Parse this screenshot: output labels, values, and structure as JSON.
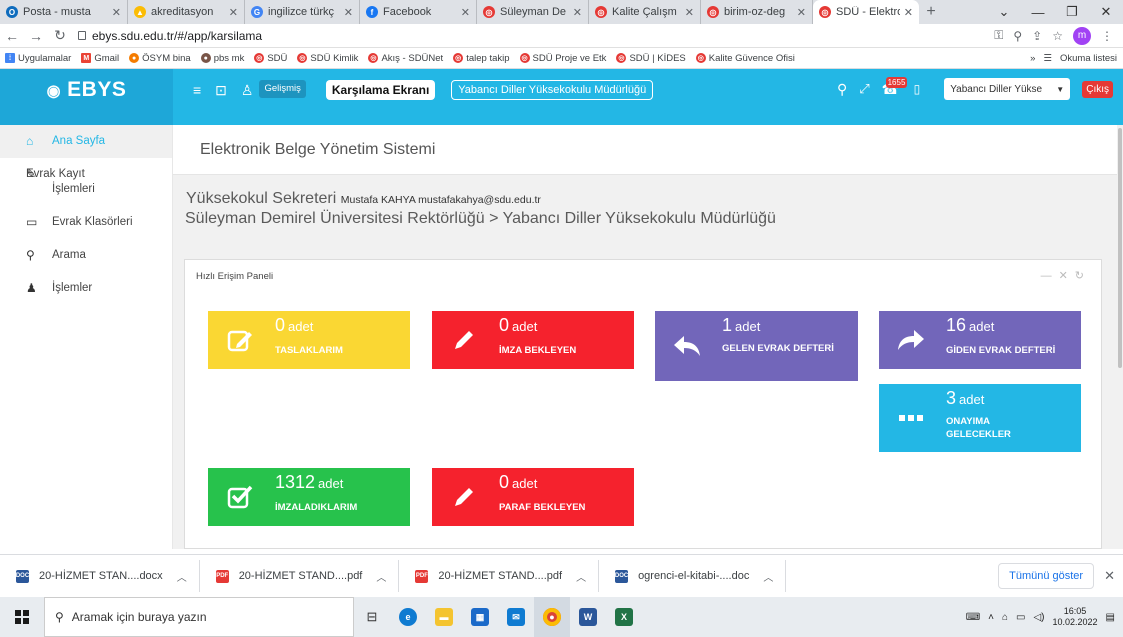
{
  "browser": {
    "tabs": [
      {
        "title": "Posta - musta",
        "icon": "outlook-icon",
        "color": "#0f6cbd",
        "glyph": "O"
      },
      {
        "title": "akreditasyon",
        "icon": "drive-icon",
        "color": "#fbbc04",
        "glyph": "▲"
      },
      {
        "title": "ingilizce türkç",
        "icon": "google-icon",
        "color": "#4285f4",
        "glyph": "G"
      },
      {
        "title": "Facebook",
        "icon": "facebook-icon",
        "color": "#1877f2",
        "glyph": "f"
      },
      {
        "title": "Süleyman De",
        "icon": "sdu-icon",
        "color": "#e53935",
        "glyph": "◎"
      },
      {
        "title": "Kalite Çalışm",
        "icon": "sdu-icon",
        "color": "#e53935",
        "glyph": "◎"
      },
      {
        "title": "birim-oz-deg",
        "icon": "sdu-icon",
        "color": "#e53935",
        "glyph": "◎"
      },
      {
        "title": "SDÜ - Elektro",
        "icon": "sdu-icon",
        "color": "#e53935",
        "glyph": "◎"
      }
    ],
    "url": "ebys.sdu.edu.tr/#/app/karsilama",
    "profile_initial": "m",
    "bookmarks": [
      {
        "label": "Uygulamalar",
        "icon": "apps-icon",
        "color": "#4285f4",
        "glyph": "⁞"
      },
      {
        "label": "Gmail",
        "icon": "gmail-icon",
        "color": "#ea4335",
        "glyph": "M"
      },
      {
        "label": "ÖSYM bina",
        "icon": "osym-icon",
        "color": "#f57c00",
        "glyph": "●"
      },
      {
        "label": "pbs mk",
        "icon": "pbs-icon",
        "color": "#795548",
        "glyph": "●"
      },
      {
        "label": "SDÜ",
        "icon": "sdu-icon",
        "color": "#e53935",
        "glyph": "◎"
      },
      {
        "label": "SDÜ Kimlik",
        "icon": "sdu-icon",
        "color": "#e53935",
        "glyph": "◎"
      },
      {
        "label": "Akış - SDÜNet",
        "icon": "sdu-icon",
        "color": "#e53935",
        "glyph": "◎"
      },
      {
        "label": "talep takip",
        "icon": "sdu-icon",
        "color": "#e53935",
        "glyph": "◎"
      },
      {
        "label": "SDÜ Proje ve Etk",
        "icon": "sdu-icon",
        "color": "#e53935",
        "glyph": "◎"
      },
      {
        "label": "SDÜ | KİDES",
        "icon": "sdu-icon",
        "color": "#e53935",
        "glyph": "◎"
      },
      {
        "label": "Kalite Güvence Ofisi",
        "icon": "sdu-icon",
        "color": "#e53935",
        "glyph": "◎"
      }
    ],
    "reading_list": "Okuma listesi"
  },
  "app": {
    "logo": "EBYS",
    "advanced": "Gelişmiş",
    "welcome": "Karşılama Ekranı",
    "unit": "Yabancı Diller Yüksekokulu Müdürlüğü",
    "notifications": "1655",
    "unit_select": "Yabancı Diller Yükse",
    "logout": "Çıkış"
  },
  "sidebar": {
    "items": [
      {
        "label": "Ana Sayfa",
        "icon": "home-icon"
      },
      {
        "label": "Evrak Kayıt İşlemleri",
        "icon": "edit-icon"
      },
      {
        "label": "Evrak Klasörleri",
        "icon": "folder-icon"
      },
      {
        "label": "Arama",
        "icon": "search-icon"
      },
      {
        "label": "İşlemler",
        "icon": "user-icon"
      }
    ]
  },
  "main": {
    "title": "Elektronik Belge Yönetim Sistemi",
    "role": "Yüksekokul Sekreteri",
    "user": "Mustafa KAHYA mustafakahya@sdu.edu.tr",
    "org": "Süleyman Demirel Üniversitesi Rektörlüğü > Yabancı Diller Yüksekokulu Müdürlüğü",
    "panel_title": "Hızlı Erişim Paneli",
    "unit_word": "adet",
    "tiles": [
      {
        "count": "0",
        "label": "TASLAKLARIM",
        "color": "#fad733"
      },
      {
        "count": "0",
        "label": "İMZA BEKLEYEN",
        "color": "#f5222d"
      },
      {
        "count": "1",
        "label": "GELEN EVRAK DEFTERİ",
        "color": "#7266ba"
      },
      {
        "count": "16",
        "label": "GİDEN EVRAK DEFTERİ",
        "color": "#7266ba"
      },
      {
        "count": "3",
        "label": "ONAYIMA GELECEKLER",
        "color": "#23b7e5"
      },
      {
        "count": "1312",
        "label": "İMZALADIKLARIM",
        "color": "#27c24c"
      },
      {
        "count": "0",
        "label": "PARAF BEKLEYEN",
        "color": "#f5222d"
      }
    ]
  },
  "downloads": {
    "items": [
      {
        "name": "20-HİZMET STAN....docx",
        "type": "DOC",
        "color": "#2b579a"
      },
      {
        "name": "20-HİZMET STAND....pdf",
        "type": "PDF",
        "color": "#e53935"
      },
      {
        "name": "20-HİZMET STAND....pdf",
        "type": "PDF",
        "color": "#e53935"
      },
      {
        "name": "ogrenci-el-kitabi-....doc",
        "type": "DOC",
        "color": "#2b579a"
      }
    ],
    "show_all": "Tümünü göster"
  },
  "taskbar": {
    "search_placeholder": "Aramak için buraya yazın",
    "time": "16:05",
    "date": "10.02.2022"
  }
}
